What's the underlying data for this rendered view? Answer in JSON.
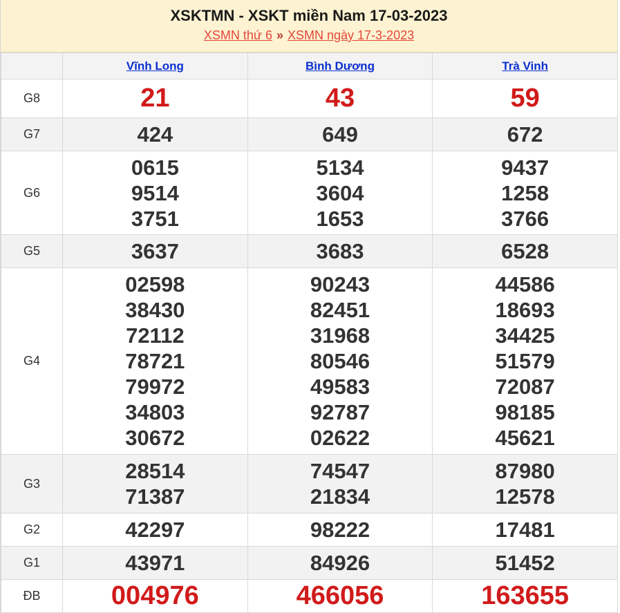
{
  "header": {
    "title": "XSKTMN - XSKT miền Nam 17-03-2023",
    "link1": "XSMN thứ 6",
    "separator": "»",
    "link2": "XSMN ngày 17-3-2023"
  },
  "columns": [
    "Vĩnh Long",
    "Bình Dương",
    "Trà Vinh"
  ],
  "rows": [
    {
      "label": "G8",
      "values": [
        [
          "21"
        ],
        [
          "43"
        ],
        [
          "59"
        ]
      ]
    },
    {
      "label": "G7",
      "values": [
        [
          "424"
        ],
        [
          "649"
        ],
        [
          "672"
        ]
      ]
    },
    {
      "label": "G6",
      "values": [
        [
          "0615",
          "9514",
          "3751"
        ],
        [
          "5134",
          "3604",
          "1653"
        ],
        [
          "9437",
          "1258",
          "3766"
        ]
      ]
    },
    {
      "label": "G5",
      "values": [
        [
          "3637"
        ],
        [
          "3683"
        ],
        [
          "6528"
        ]
      ]
    },
    {
      "label": "G4",
      "values": [
        [
          "02598",
          "38430",
          "72112",
          "78721",
          "79972",
          "34803",
          "30672"
        ],
        [
          "90243",
          "82451",
          "31968",
          "80546",
          "49583",
          "92787",
          "02622"
        ],
        [
          "44586",
          "18693",
          "34425",
          "51579",
          "72087",
          "98185",
          "45621"
        ]
      ]
    },
    {
      "label": "G3",
      "values": [
        [
          "28514",
          "71387"
        ],
        [
          "74547",
          "21834"
        ],
        [
          "87980",
          "12578"
        ]
      ]
    },
    {
      "label": "G2",
      "values": [
        [
          "42297"
        ],
        [
          "98222"
        ],
        [
          "17481"
        ]
      ]
    },
    {
      "label": "G1",
      "values": [
        [
          "43971"
        ],
        [
          "84926"
        ],
        [
          "51452"
        ]
      ]
    },
    {
      "label": "ĐB",
      "values": [
        [
          "004976"
        ],
        [
          "466056"
        ],
        [
          "163655"
        ]
      ]
    }
  ]
}
